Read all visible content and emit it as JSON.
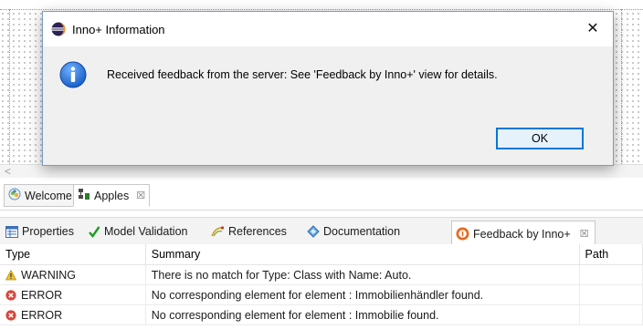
{
  "dialog": {
    "title": "Inno+ Information",
    "close_glyph": "✕",
    "message": "Received feedback from the server: See 'Feedback by Inno+' view for details.",
    "ok_label": "OK",
    "icon": "info-icon"
  },
  "scrollbar": {
    "left_arrow": "<"
  },
  "editor_tabs": [
    {
      "label": "Welcome",
      "icon": "welcome-icon",
      "active": false
    },
    {
      "label": "Apples",
      "icon": "diagram-icon",
      "active": true,
      "close": "☒"
    }
  ],
  "view_tabs": [
    {
      "label": "Properties",
      "icon": "properties-icon"
    },
    {
      "label": "Model Validation",
      "icon": "checkmark-icon"
    },
    {
      "label": "References",
      "icon": "references-icon"
    },
    {
      "label": "Documentation",
      "icon": "documentation-icon"
    },
    {
      "label": "Feedback by Inno+",
      "icon": "feedback-icon",
      "active": true,
      "close": "☒"
    }
  ],
  "table": {
    "headers": [
      "Type",
      "Summary",
      "Path"
    ],
    "rows": [
      {
        "type": "WARNING",
        "summary": "There is no match for Type: Class with Name: Auto.",
        "path": "",
        "icon": "warning-icon"
      },
      {
        "type": "ERROR",
        "summary": "No corresponding element for element : Immobilienhändler found.",
        "path": "",
        "icon": "error-icon"
      },
      {
        "type": "ERROR",
        "summary": "No corresponding element for element : Immobilie found.",
        "path": "",
        "icon": "error-icon"
      }
    ]
  },
  "colors": {
    "info_blue": "#1f6fd1",
    "warning_yellow": "#f2c230",
    "error_red": "#d9463b",
    "ok_border": "#0078d7"
  }
}
